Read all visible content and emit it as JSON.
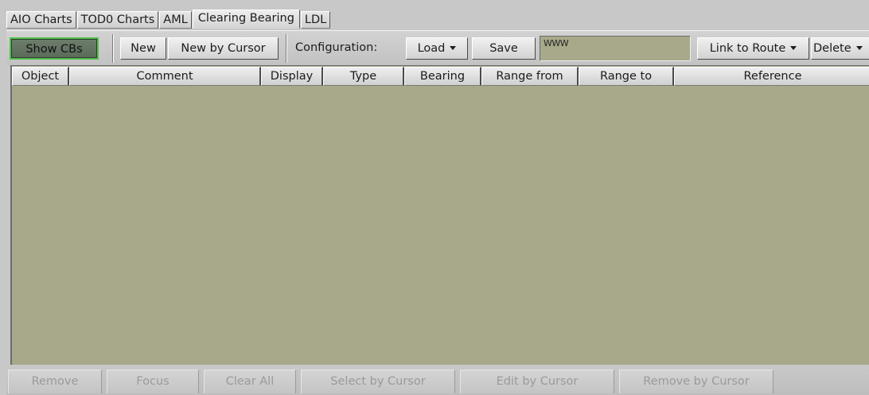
{
  "tabs": [
    {
      "label": "AIO Charts",
      "active": false
    },
    {
      "label": "TOD0 Charts",
      "active": false
    },
    {
      "label": "AML",
      "active": false
    },
    {
      "label": "Clearing Bearing",
      "active": true
    },
    {
      "label": "LDL",
      "active": false
    }
  ],
  "toolbar": {
    "show_cbs_label": "Show CBs",
    "show_cbs_on": true,
    "new_label": "New",
    "new_by_cursor_label": "New by Cursor",
    "configuration_label": "Configuration:",
    "load_label": "Load",
    "save_label": "Save",
    "config_name_value": "WWW",
    "link_to_route_label": "Link to Route",
    "delete_label": "Delete"
  },
  "table": {
    "columns": [
      "Object",
      "Comment",
      "Display",
      "Type",
      "Bearing",
      "Range from",
      "Range to",
      "Reference"
    ],
    "rows": []
  },
  "actions": {
    "remove_label": "Remove",
    "focus_label": "Focus",
    "clear_all_label": "Clear All",
    "select_by_cursor_label": "Select by Cursor",
    "edit_by_cursor_label": "Edit by Cursor",
    "remove_by_cursor_label": "Remove by Cursor",
    "enabled": false
  },
  "colors": {
    "panel_background": "#c8c8c8",
    "table_background": "#a8a98a",
    "toggle_active_border": "#4fc04a",
    "toggle_active_fill": "#66765f",
    "disabled_text": "#9a9a9a"
  }
}
